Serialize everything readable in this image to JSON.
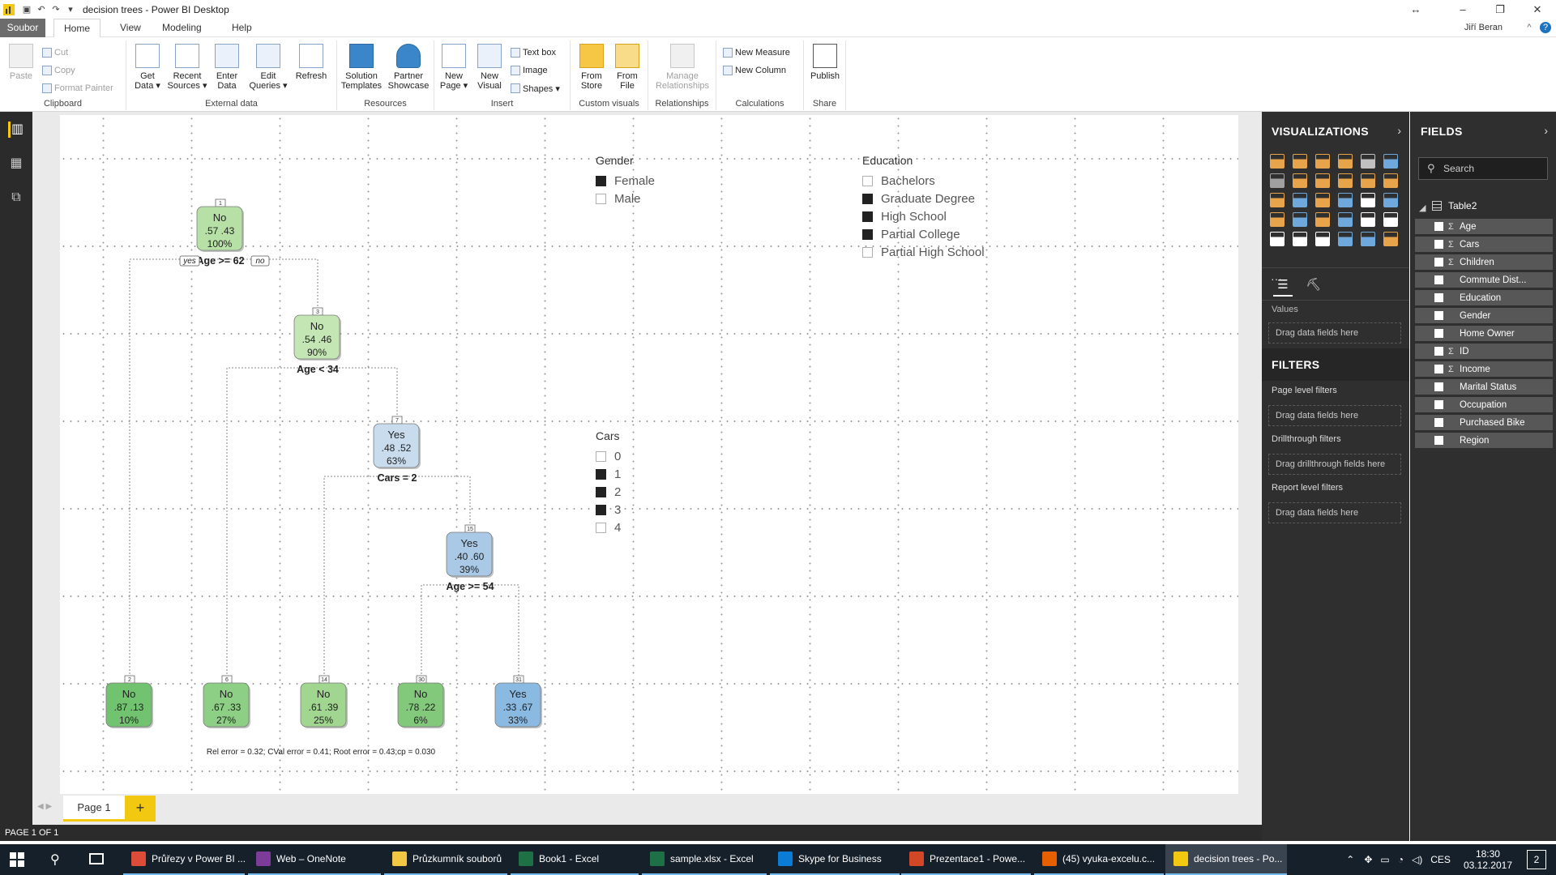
{
  "window": {
    "title": "decision trees - Power BI Desktop",
    "user": "Jiří Beran"
  },
  "ribbon_tabs": [
    "Soubor",
    "Home",
    "View",
    "Modeling",
    "Help"
  ],
  "ribbon": {
    "clipboard": {
      "label": "Clipboard",
      "paste": "Paste",
      "cut": "Cut",
      "copy": "Copy",
      "format_painter": "Format Painter"
    },
    "external_data": {
      "label": "External data",
      "get_data": [
        "Get",
        "Data ▾"
      ],
      "recent_sources": [
        "Recent",
        "Sources ▾"
      ],
      "enter_data": [
        "Enter",
        "Data"
      ],
      "edit_queries": [
        "Edit",
        "Queries ▾"
      ],
      "refresh": "Refresh"
    },
    "resources": {
      "label": "Resources",
      "solution_templates": [
        "Solution",
        "Templates"
      ],
      "partner_showcase": [
        "Partner",
        "Showcase"
      ]
    },
    "insert": {
      "label": "Insert",
      "new_page": [
        "New",
        "Page ▾"
      ],
      "new_visual": [
        "New",
        "Visual"
      ],
      "text_box": "Text box",
      "image": "Image",
      "shapes": "Shapes ▾"
    },
    "custom_visuals": {
      "label": "Custom visuals",
      "from_store": [
        "From",
        "Store"
      ],
      "from_file": [
        "From",
        "File"
      ]
    },
    "relationships": {
      "label": "Relationships",
      "manage": [
        "Manage",
        "Relationships"
      ]
    },
    "calculations": {
      "label": "Calculations",
      "new_measure": "New Measure",
      "new_column": "New Column"
    },
    "share": {
      "label": "Share",
      "publish": "Publish"
    }
  },
  "slicers": {
    "gender": {
      "title": "Gender",
      "items": [
        {
          "label": "Female",
          "checked": true
        },
        {
          "label": "Male",
          "checked": false
        }
      ]
    },
    "education": {
      "title": "Education",
      "items": [
        {
          "label": "Bachelors",
          "checked": false
        },
        {
          "label": "Graduate Degree",
          "checked": true
        },
        {
          "label": "High School",
          "checked": true
        },
        {
          "label": "Partial College",
          "checked": true
        },
        {
          "label": "Partial High School",
          "checked": false
        }
      ]
    },
    "cars": {
      "title": "Cars",
      "items": [
        {
          "label": "0",
          "checked": false
        },
        {
          "label": "1",
          "checked": true
        },
        {
          "label": "2",
          "checked": true
        },
        {
          "label": "3",
          "checked": true
        },
        {
          "label": "4",
          "checked": false
        }
      ]
    }
  },
  "tree": {
    "nodes": [
      {
        "id": "1",
        "cls": "No",
        "p": ".57  .43",
        "pct": "100%",
        "color": "#b6e0a6",
        "split": "Age >= 62"
      },
      {
        "id": "3",
        "cls": "No",
        "p": ".54  .46",
        "pct": "90%",
        "color": "#c4e6b4",
        "split": "Age < 34"
      },
      {
        "id": "7",
        "cls": "Yes",
        "p": ".48  .52",
        "pct": "63%",
        "color": "#c9dcee",
        "split": "Cars = 2"
      },
      {
        "id": "15",
        "cls": "Yes",
        "p": ".40  .60",
        "pct": "39%",
        "color": "#a9c9e6",
        "split": "Age >= 54"
      },
      {
        "id": "2",
        "cls": "No",
        "p": ".87  .13",
        "pct": "10%",
        "color": "#71c36f"
      },
      {
        "id": "6",
        "cls": "No",
        "p": ".67  .33",
        "pct": "27%",
        "color": "#8dcf85"
      },
      {
        "id": "14",
        "cls": "No",
        "p": ".61  .39",
        "pct": "25%",
        "color": "#a0d68f"
      },
      {
        "id": "30",
        "cls": "No",
        "p": ".78  .22",
        "pct": "6%",
        "color": "#82c97c"
      },
      {
        "id": "31",
        "cls": "Yes",
        "p": ".33  .67",
        "pct": "33%",
        "color": "#8ab9e2"
      }
    ],
    "yes_label": "yes",
    "no_label": "no",
    "footer": "Rel error  =  0.32; CVal error  =  0.41; Root error  =  0.43;cp  =  0.030"
  },
  "pages": {
    "tab": "Page 1",
    "add": "+",
    "status": "PAGE 1 OF 1"
  },
  "visualizations": {
    "title": "VISUALIZATIONS",
    "values_label": "Values",
    "values_drop": "Drag data fields here"
  },
  "filters": {
    "title": "FILTERS",
    "page_level": "Page level filters",
    "page_drop": "Drag data fields here",
    "drill": "Drillthrough filters",
    "drill_drop": "Drag drillthrough fields here",
    "report": "Report level filters",
    "report_drop": "Drag data fields here"
  },
  "fields": {
    "title": "FIELDS",
    "search_placeholder": "Search",
    "table": "Table2",
    "items": [
      {
        "name": "Age",
        "sigma": true
      },
      {
        "name": "Cars",
        "sigma": true
      },
      {
        "name": "Children",
        "sigma": true
      },
      {
        "name": "Commute Dist...",
        "sigma": false
      },
      {
        "name": "Education",
        "sigma": false
      },
      {
        "name": "Gender",
        "sigma": false
      },
      {
        "name": "Home Owner",
        "sigma": false
      },
      {
        "name": "ID",
        "sigma": true
      },
      {
        "name": "Income",
        "sigma": true
      },
      {
        "name": "Marital Status",
        "sigma": false
      },
      {
        "name": "Occupation",
        "sigma": false
      },
      {
        "name": "Purchased Bike",
        "sigma": false
      },
      {
        "name": "Region",
        "sigma": false
      }
    ]
  },
  "taskbar": {
    "apps": [
      {
        "label": "Průřezy v Power BI ...",
        "color": "#dd4b39"
      },
      {
        "label": "Web – OneNote",
        "color": "#7d3c98"
      },
      {
        "label": "Průzkumník souborů",
        "color": "#f2c744"
      },
      {
        "label": "Book1 - Excel",
        "color": "#1e7145"
      },
      {
        "label": "sample.xlsx - Excel",
        "color": "#1e7145"
      },
      {
        "label": "Skype for Business",
        "color": "#0a7cd6"
      },
      {
        "label": "Prezentace1 - Powe...",
        "color": "#d24726"
      },
      {
        "label": "(45) vyuka-excelu.c...",
        "color": "#e66000"
      },
      {
        "label": "decision trees - Po...",
        "color": "#f2c811"
      }
    ],
    "lang": "CES",
    "time": "18:30",
    "date": "03.12.2017",
    "notifications": "2"
  }
}
